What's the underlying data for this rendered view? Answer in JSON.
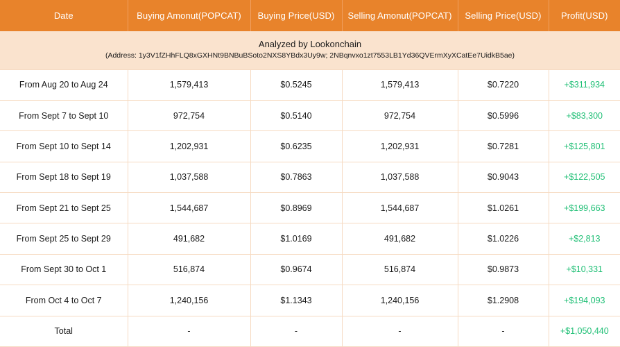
{
  "table": {
    "columns": [
      {
        "key": "date",
        "label": "Date"
      },
      {
        "key": "buying_amount",
        "label": "Buying Amonut(POPCAT)"
      },
      {
        "key": "buying_price",
        "label": "Buying Price(USD)"
      },
      {
        "key": "selling_amount",
        "label": "Selling Amonut(POPCAT)"
      },
      {
        "key": "selling_price",
        "label": "Selling Price(USD)"
      },
      {
        "key": "profit",
        "label": "Profit(USD)"
      }
    ],
    "subtitle": {
      "credit": "Analyzed by Lookonchain",
      "address_line": "(Address: 1y3V1fZHhFLQ8xGXHNt9BNBuBSoto2NXS8YBdx3Uy9w; 2NBqnvxo1zt7553LB1Yd36QVErmXyXCatEe7UidkB5ae)"
    },
    "rows": [
      {
        "date": "From Aug 20 to Aug 24",
        "buying_amount": "1,579,413",
        "buying_price": "$0.5245",
        "selling_amount": "1,579,413",
        "selling_price": "$0.7220",
        "profit": "+$311,934"
      },
      {
        "date": "From Sept 7 to Sept 10",
        "buying_amount": "972,754",
        "buying_price": "$0.5140",
        "selling_amount": "972,754",
        "selling_price": "$0.5996",
        "profit": "+$83,300"
      },
      {
        "date": "From Sept 10 to Sept 14",
        "buying_amount": "1,202,931",
        "buying_price": "$0.6235",
        "selling_amount": "1,202,931",
        "selling_price": "$0.7281",
        "profit": "+$125,801"
      },
      {
        "date": "From Sept 18 to Sept 19",
        "buying_amount": "1,037,588",
        "buying_price": "$0.7863",
        "selling_amount": "1,037,588",
        "selling_price": "$0.9043",
        "profit": "+$122,505"
      },
      {
        "date": "From Sept 21 to Sept 25",
        "buying_amount": "1,544,687",
        "buying_price": "$0.8969",
        "selling_amount": "1,544,687",
        "selling_price": "$1.0261",
        "profit": "+$199,663"
      },
      {
        "date": "From Sept 25 to Sept 29",
        "buying_amount": "491,682",
        "buying_price": "$1.0169",
        "selling_amount": "491,682",
        "selling_price": "$1.0226",
        "profit": "+$2,813"
      },
      {
        "date": "From Sept 30 to Oct 1",
        "buying_amount": "516,874",
        "buying_price": "$0.9674",
        "selling_amount": "516,874",
        "selling_price": "$0.9873",
        "profit": "+$10,331"
      },
      {
        "date": "From Oct 4 to Oct 7",
        "buying_amount": "1,240,156",
        "buying_price": "$1.1343",
        "selling_amount": "1,240,156",
        "selling_price": "$1.2908",
        "profit": "+$194,093"
      }
    ],
    "total_row": {
      "date": "Total",
      "buying_amount": "-",
      "buying_price": "-",
      "selling_amount": "-",
      "selling_price": "-",
      "profit": "+$1,050,440"
    }
  },
  "colors": {
    "header_background": "#E8832B",
    "header_text": "#FFFFFF",
    "subtitle_background": "#FAE3CE",
    "grid_line": "#F6DAC1",
    "body_text": "#1A1A1A",
    "profit_positive": "#1FBF75",
    "row_background": "#FFFFFF"
  }
}
